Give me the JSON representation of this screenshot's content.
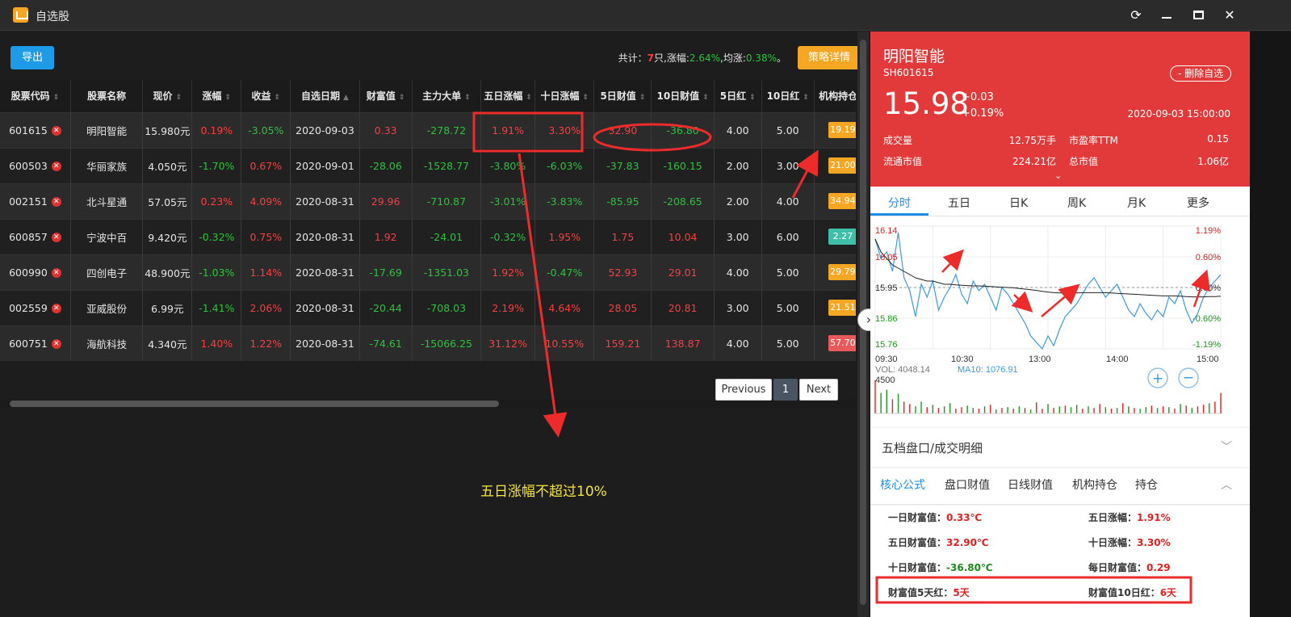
{
  "window": {
    "title": "自选股"
  },
  "toolbar": {
    "export_label": "导出",
    "strategy_label": "策略详情"
  },
  "summary": {
    "prefix": "共计：",
    "count": "7",
    "mid": "只,涨幅:",
    "gain": "2.64%",
    "mid2": ",均涨:",
    "avg": "0.38%",
    "suffix": "。"
  },
  "table": {
    "headers": [
      "股票代码",
      "股票名称",
      "现价",
      "涨幅",
      "收益",
      "自选日期",
      "财富值",
      "主力大单",
      "五日涨幅",
      "十日涨幅",
      "5日财值",
      "10日财值",
      "5日红",
      "10日红",
      "机构持仓"
    ],
    "rows": [
      {
        "code": "601615",
        "name": "明阳智能",
        "price": "15.980元",
        "chg": "0.19%",
        "chg_c": "r",
        "profit": "-3.05%",
        "profit_c": "g",
        "date": "2020-09-03",
        "wealth": "0.33",
        "wealth_c": "r",
        "main": "-278.72",
        "main_c": "g",
        "d5": "1.91%",
        "d5_c": "r",
        "d10": "3.30%",
        "d10_c": "r",
        "w5": "32.90",
        "w5_c": "r",
        "w10": "-36.80",
        "w10_c": "g",
        "red5": "4.00",
        "red10": "5.00",
        "inst": "19.19",
        "inst_color": "#f5a623"
      },
      {
        "code": "600503",
        "name": "华丽家族",
        "price": "4.050元",
        "chg": "-1.70%",
        "chg_c": "g",
        "profit": "0.67%",
        "profit_c": "r",
        "date": "2020-09-01",
        "wealth": "-28.06",
        "wealth_c": "g",
        "main": "-1528.77",
        "main_c": "g",
        "d5": "-3.80%",
        "d5_c": "g",
        "d10": "-6.03%",
        "d10_c": "g",
        "w5": "-37.83",
        "w5_c": "g",
        "w10": "-160.15",
        "w10_c": "g",
        "red5": "2.00",
        "red10": "3.00",
        "inst": "21.00",
        "inst_color": "#f5a623"
      },
      {
        "code": "002151",
        "name": "北斗星通",
        "price": "57.05元",
        "chg": "0.23%",
        "chg_c": "r",
        "profit": "4.09%",
        "profit_c": "r",
        "date": "2020-08-31",
        "wealth": "29.96",
        "wealth_c": "r",
        "main": "-710.87",
        "main_c": "g",
        "d5": "-3.01%",
        "d5_c": "g",
        "d10": "-3.83%",
        "d10_c": "g",
        "w5": "-85.95",
        "w5_c": "g",
        "w10": "-208.65",
        "w10_c": "g",
        "red5": "2.00",
        "red10": "4.00",
        "inst": "34.94",
        "inst_color": "#f5a623"
      },
      {
        "code": "600857",
        "name": "宁波中百",
        "price": "9.420元",
        "chg": "-0.32%",
        "chg_c": "g",
        "profit": "0.75%",
        "profit_c": "r",
        "date": "2020-08-31",
        "wealth": "1.92",
        "wealth_c": "r",
        "main": "-24.01",
        "main_c": "g",
        "d5": "-0.32%",
        "d5_c": "g",
        "d10": "1.95%",
        "d10_c": "r",
        "w5": "1.75",
        "w5_c": "r",
        "w10": "10.04",
        "w10_c": "r",
        "red5": "3.00",
        "red10": "6.00",
        "inst": "2.27",
        "inst_color": "#3fbfa8"
      },
      {
        "code": "600990",
        "name": "四创电子",
        "price": "48.900元",
        "chg": "-1.03%",
        "chg_c": "g",
        "profit": "1.14%",
        "profit_c": "r",
        "date": "2020-08-31",
        "wealth": "-17.69",
        "wealth_c": "g",
        "main": "-1351.03",
        "main_c": "g",
        "d5": "1.92%",
        "d5_c": "r",
        "d10": "-0.47%",
        "d10_c": "g",
        "w5": "52.93",
        "w5_c": "r",
        "w10": "29.01",
        "w10_c": "r",
        "red5": "4.00",
        "red10": "5.00",
        "inst": "29.79",
        "inst_color": "#f5a623"
      },
      {
        "code": "002559",
        "name": "亚威股份",
        "price": "6.99元",
        "chg": "-1.41%",
        "chg_c": "g",
        "profit": "2.06%",
        "profit_c": "r",
        "date": "2020-08-31",
        "wealth": "-20.44",
        "wealth_c": "g",
        "main": "-708.03",
        "main_c": "g",
        "d5": "2.19%",
        "d5_c": "r",
        "d10": "4.64%",
        "d10_c": "r",
        "w5": "28.05",
        "w5_c": "r",
        "w10": "20.81",
        "w10_c": "r",
        "red5": "3.00",
        "red10": "5.00",
        "inst": "21.51",
        "inst_color": "#f5a623"
      },
      {
        "code": "600751",
        "name": "海航科技",
        "price": "4.340元",
        "chg": "1.40%",
        "chg_c": "r",
        "profit": "1.22%",
        "profit_c": "r",
        "date": "2020-08-31",
        "wealth": "-74.61",
        "wealth_c": "g",
        "main": "-15066.25",
        "main_c": "g",
        "d5": "31.12%",
        "d5_c": "r",
        "d10": "10.55%",
        "d10_c": "r",
        "w5": "159.21",
        "w5_c": "r",
        "w10": "138.87",
        "w10_c": "r",
        "red5": "4.00",
        "red10": "5.00",
        "inst": "57.70",
        "inst_color": "#e95a5a"
      }
    ]
  },
  "pagination": {
    "prev": "Previous",
    "page": "1",
    "next": "Next"
  },
  "annotation": {
    "text": "五日涨幅不超过10%"
  },
  "quote": {
    "name": "明阳智能",
    "code": "SH601615",
    "remove": "- 删除自选",
    "price": "15.98",
    "change": "+0.03",
    "change_pct": "+0.19%",
    "time": "2020-09-03 15:00:00",
    "volume_label": "成交量",
    "volume": "12.75万手",
    "pe_label": "市盈率TTM",
    "pe": "0.15",
    "float_cap_label": "流通市值",
    "float_cap": "224.21亿",
    "total_cap_label": "总市值",
    "total_cap": "1.06亿"
  },
  "chart_tabs": [
    "分时",
    "五日",
    "日K",
    "周K",
    "月K",
    "更多"
  ],
  "chart_data": {
    "type": "line",
    "title": "",
    "x_ticks": [
      "09:30",
      "10:30",
      "13:00",
      "14:00",
      "15:00"
    ],
    "y_left_ticks": [
      "16.14",
      "16.05",
      "15.95",
      "15.86",
      "15.76"
    ],
    "y_right_ticks": [
      "1.19%",
      "0.60%",
      "0.00%",
      "-0.60%",
      "-1.19%"
    ],
    "ylim": [
      15.76,
      16.14
    ],
    "prev_close": 15.95,
    "series": [
      {
        "values": [
          16.1,
          16.04,
          16.06,
          16.0,
          16.12,
          15.98,
          15.94,
          15.86,
          15.96,
          15.92,
          15.97,
          15.88,
          15.92,
          15.95,
          15.99,
          15.93,
          15.9,
          15.97,
          15.94,
          15.96,
          15.92,
          15.88,
          15.95,
          15.93,
          15.9,
          15.87,
          15.84,
          15.8,
          15.78,
          15.76,
          15.8,
          15.77,
          15.82,
          15.86,
          15.88,
          15.9,
          15.93,
          15.96,
          15.98,
          15.95,
          15.92,
          15.94,
          15.96,
          15.92,
          15.88,
          15.86,
          15.9,
          15.87,
          15.85,
          15.88,
          15.86,
          15.92,
          15.9,
          15.94,
          15.88,
          15.84,
          15.87,
          15.92,
          15.95,
          15.97,
          15.99
        ]
      },
      {
        "values": [
          16.1,
          16.06,
          16.04,
          16.02,
          16.01,
          16.0,
          15.99,
          15.98,
          15.975,
          15.97,
          15.97,
          15.965,
          15.96,
          15.96,
          15.958,
          15.957,
          15.956,
          15.955,
          15.955,
          15.954,
          15.953,
          15.952,
          15.951,
          15.95,
          15.949,
          15.947,
          15.945,
          15.943,
          15.941,
          15.938,
          15.936,
          15.934,
          15.933,
          15.933,
          15.933,
          15.933,
          15.934,
          15.934,
          15.934,
          15.934,
          15.934,
          15.933,
          15.932,
          15.931,
          15.93,
          15.929,
          15.928,
          15.927,
          15.926,
          15.925,
          15.924,
          15.924,
          15.924,
          15.923,
          15.922,
          15.921,
          15.921,
          15.921,
          15.922,
          15.922,
          15.923
        ]
      }
    ],
    "volume_label": "VOL: 4048.14",
    "ma10_label": "MA10: 1076.91",
    "vol_max_tick": "4500",
    "volume": [
      4200,
      2600,
      3000,
      1800,
      2500,
      1500,
      1200,
      900,
      1500,
      800,
      1100,
      700,
      900,
      1300,
      600,
      800,
      1000,
      700,
      600,
      900,
      1100,
      500,
      700,
      800,
      600,
      900,
      700,
      500,
      1400,
      600,
      1200,
      700,
      900,
      1000,
      800,
      1100,
      600,
      900,
      700,
      1200,
      800,
      600,
      700,
      1300,
      900,
      700,
      600,
      800,
      1000,
      700,
      900,
      800,
      600,
      1200,
      1000,
      700,
      900,
      1100,
      1300,
      1500,
      2600
    ],
    "volume_colors": [
      "r",
      "g",
      "g",
      "r",
      "g",
      "r",
      "r",
      "g",
      "g",
      "r",
      "g",
      "r",
      "g",
      "g",
      "r",
      "r",
      "g",
      "g",
      "r",
      "g",
      "r",
      "g",
      "r",
      "g",
      "r",
      "g",
      "r",
      "g",
      "r",
      "r",
      "g",
      "r",
      "g",
      "r",
      "g",
      "g",
      "r",
      "g",
      "r",
      "r",
      "g",
      "r",
      "g",
      "r",
      "g",
      "r",
      "g",
      "g",
      "r",
      "g",
      "r",
      "g",
      "r",
      "g",
      "r",
      "g",
      "r",
      "r",
      "g",
      "r",
      "r"
    ]
  },
  "panels": {
    "depth_title": "五档盘口/成交明细"
  },
  "sub_tabs": [
    "核心公式",
    "盘口财值",
    "日线财值",
    "机构持仓",
    "持仓"
  ],
  "formulas": [
    {
      "label": "一日财富值：",
      "value": "0.33℃",
      "c": "v-r"
    },
    {
      "label": "五日涨幅：",
      "value": "1.91%",
      "c": "v-r"
    },
    {
      "label": "五日财富值：",
      "value": "32.90℃",
      "c": "v-r"
    },
    {
      "label": "十日涨幅：",
      "value": "3.30%",
      "c": "v-r"
    },
    {
      "label": "十日财富值：",
      "value": "-36.80℃",
      "c": "v-g"
    },
    {
      "label": "每日财富值：",
      "value": "0.29",
      "c": "v-r"
    },
    {
      "label": "财富值5天红：",
      "value": "5天",
      "c": "v-r"
    },
    {
      "label": "财富值10日红：",
      "value": "6天",
      "c": "v-r"
    }
  ]
}
